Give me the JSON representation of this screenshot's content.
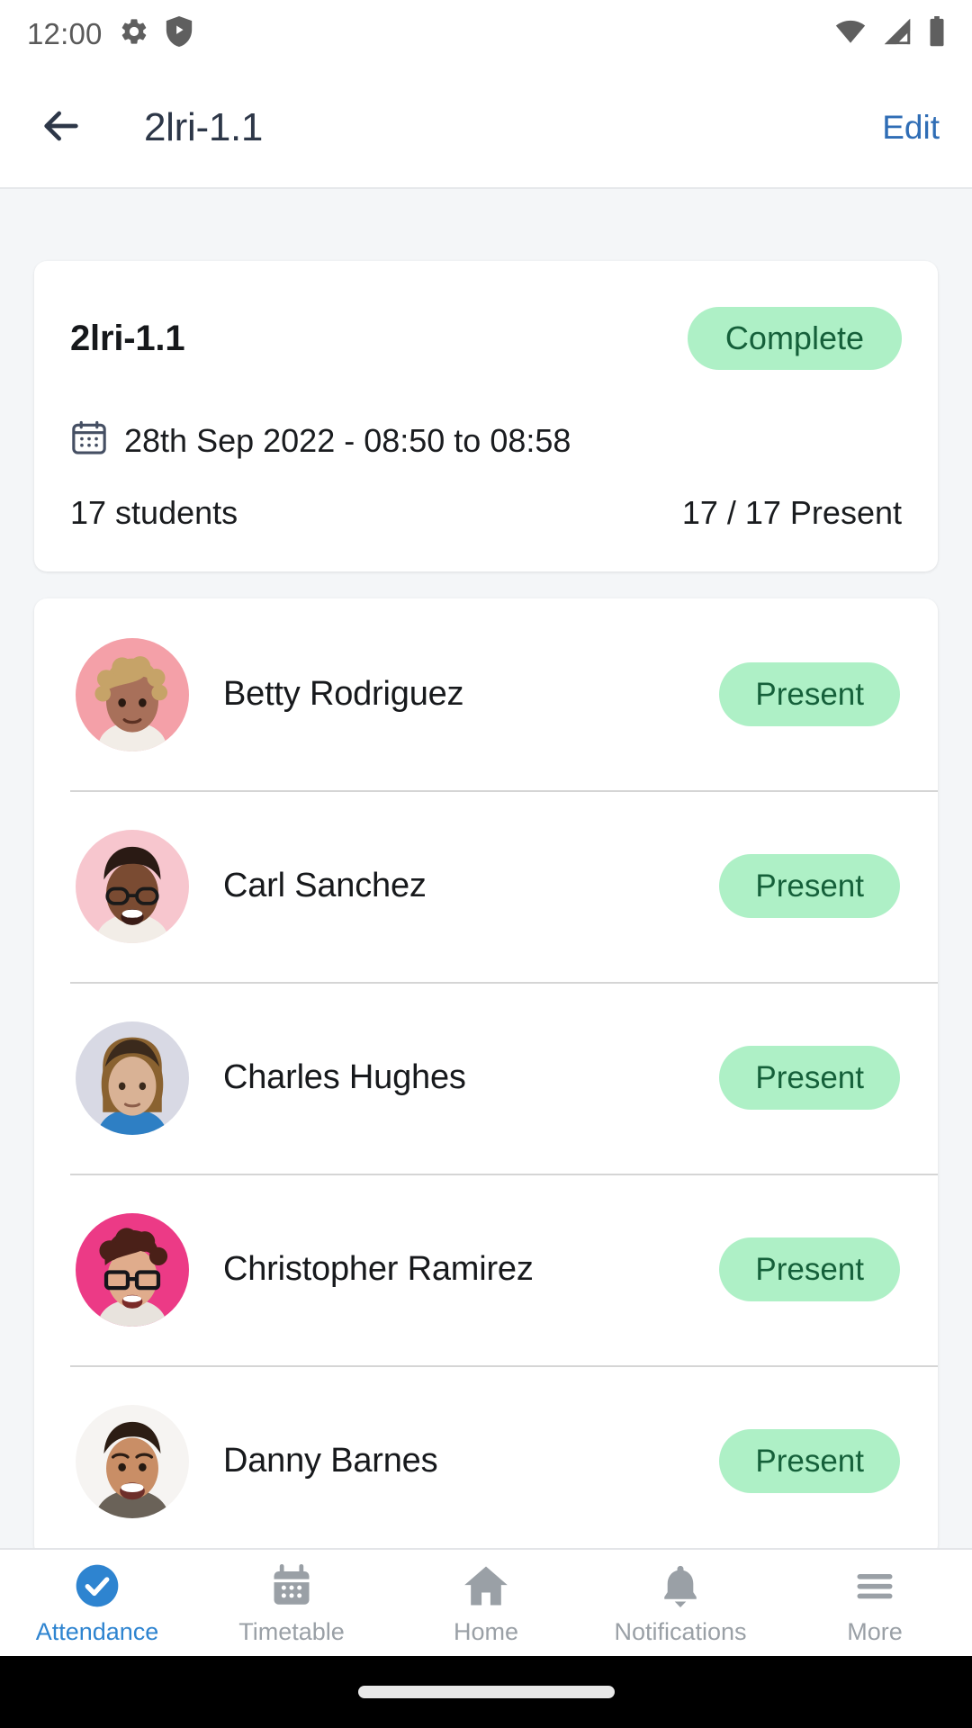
{
  "status_bar": {
    "time": "12:00",
    "left_icons": [
      "gear-icon",
      "play-protect-shield-icon"
    ],
    "right_icons": [
      "wifi-icon",
      "cellular-signal-icon",
      "battery-icon"
    ]
  },
  "header": {
    "back_icon": "arrow-left-icon",
    "title": "2lri-1.1",
    "edit_label": "Edit",
    "edit_color": "#2F6DB5"
  },
  "summary": {
    "title": "2lri-1.1",
    "status_badge": "Complete",
    "badge_bg": "#AEF0C6",
    "badge_fg": "#15603A",
    "calendar_icon": "calendar-icon",
    "date_time": "28th Sep 2022 - 08:50 to 08:58",
    "student_count": "17 students",
    "present_count": "17 / 17 Present"
  },
  "students": [
    {
      "name": "Betty Rodriguez",
      "status": "Present",
      "avatar_bg": "#F4A0A8",
      "hair": "#C6A368",
      "skin": "#A8705A"
    },
    {
      "name": "Carl Sanchez",
      "status": "Present",
      "avatar_bg": "#F7C6CE",
      "hair": "#2A1A14",
      "skin": "#7A4B32"
    },
    {
      "name": "Charles Hughes",
      "status": "Present",
      "avatar_bg": "#D8D9E4",
      "hair": "#3B2A1C",
      "skin": "#D9B295"
    },
    {
      "name": "Christopher Ramirez",
      "status": "Present",
      "avatar_bg": "#EC3A86",
      "hair": "#4A2018",
      "skin": "#E0AC8C"
    },
    {
      "name": "Danny Barnes",
      "status": "Present",
      "avatar_bg": "#F6F4F2",
      "hair": "#2C1D14",
      "skin": "#C98E66"
    }
  ],
  "bottom_nav": {
    "items": [
      {
        "label": "Attendance",
        "icon": "check-circle-icon",
        "active": true
      },
      {
        "label": "Timetable",
        "icon": "calendar-icon",
        "active": false
      },
      {
        "label": "Home",
        "icon": "home-icon",
        "active": false
      },
      {
        "label": "Notifications",
        "icon": "bell-icon",
        "active": false
      },
      {
        "label": "More",
        "icon": "hamburger-menu-icon",
        "active": false
      }
    ],
    "active_color": "#2E84D0",
    "inactive_color": "#9AA0A6"
  }
}
